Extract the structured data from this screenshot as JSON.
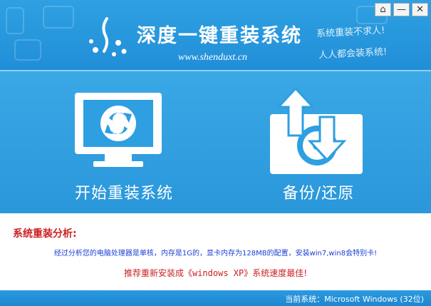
{
  "header": {
    "title": "深度一键重装系统",
    "url": "www.shenduxt.cn",
    "slogan_1": "系统重装不求人!",
    "slogan_2": "人人都会装系统!"
  },
  "window_controls": {
    "home": "⌂",
    "minimize": "—",
    "close": "✕"
  },
  "actions": {
    "reinstall_label": "开始重装系统",
    "backup_label": "备份/还原"
  },
  "analysis": {
    "title": "系统重装分析:",
    "detail": "经过分析您的电脑处理器是单核，内存是1G的，显卡内存为128MB的配置，安装win7,win8会特别卡!",
    "reco_prefix": "推荐重新安装成",
    "reco_os": "《windows XP》",
    "reco_suffix": "系统速度最佳!"
  },
  "status": {
    "current_system": "当前系统：Microsoft Windows (32位)"
  },
  "colors": {
    "header_blue": "#2b9ae0",
    "panel_blue": "#3aa8e5",
    "alert_red": "#cc1f1f",
    "detail_blue": "#1a3fd6"
  }
}
